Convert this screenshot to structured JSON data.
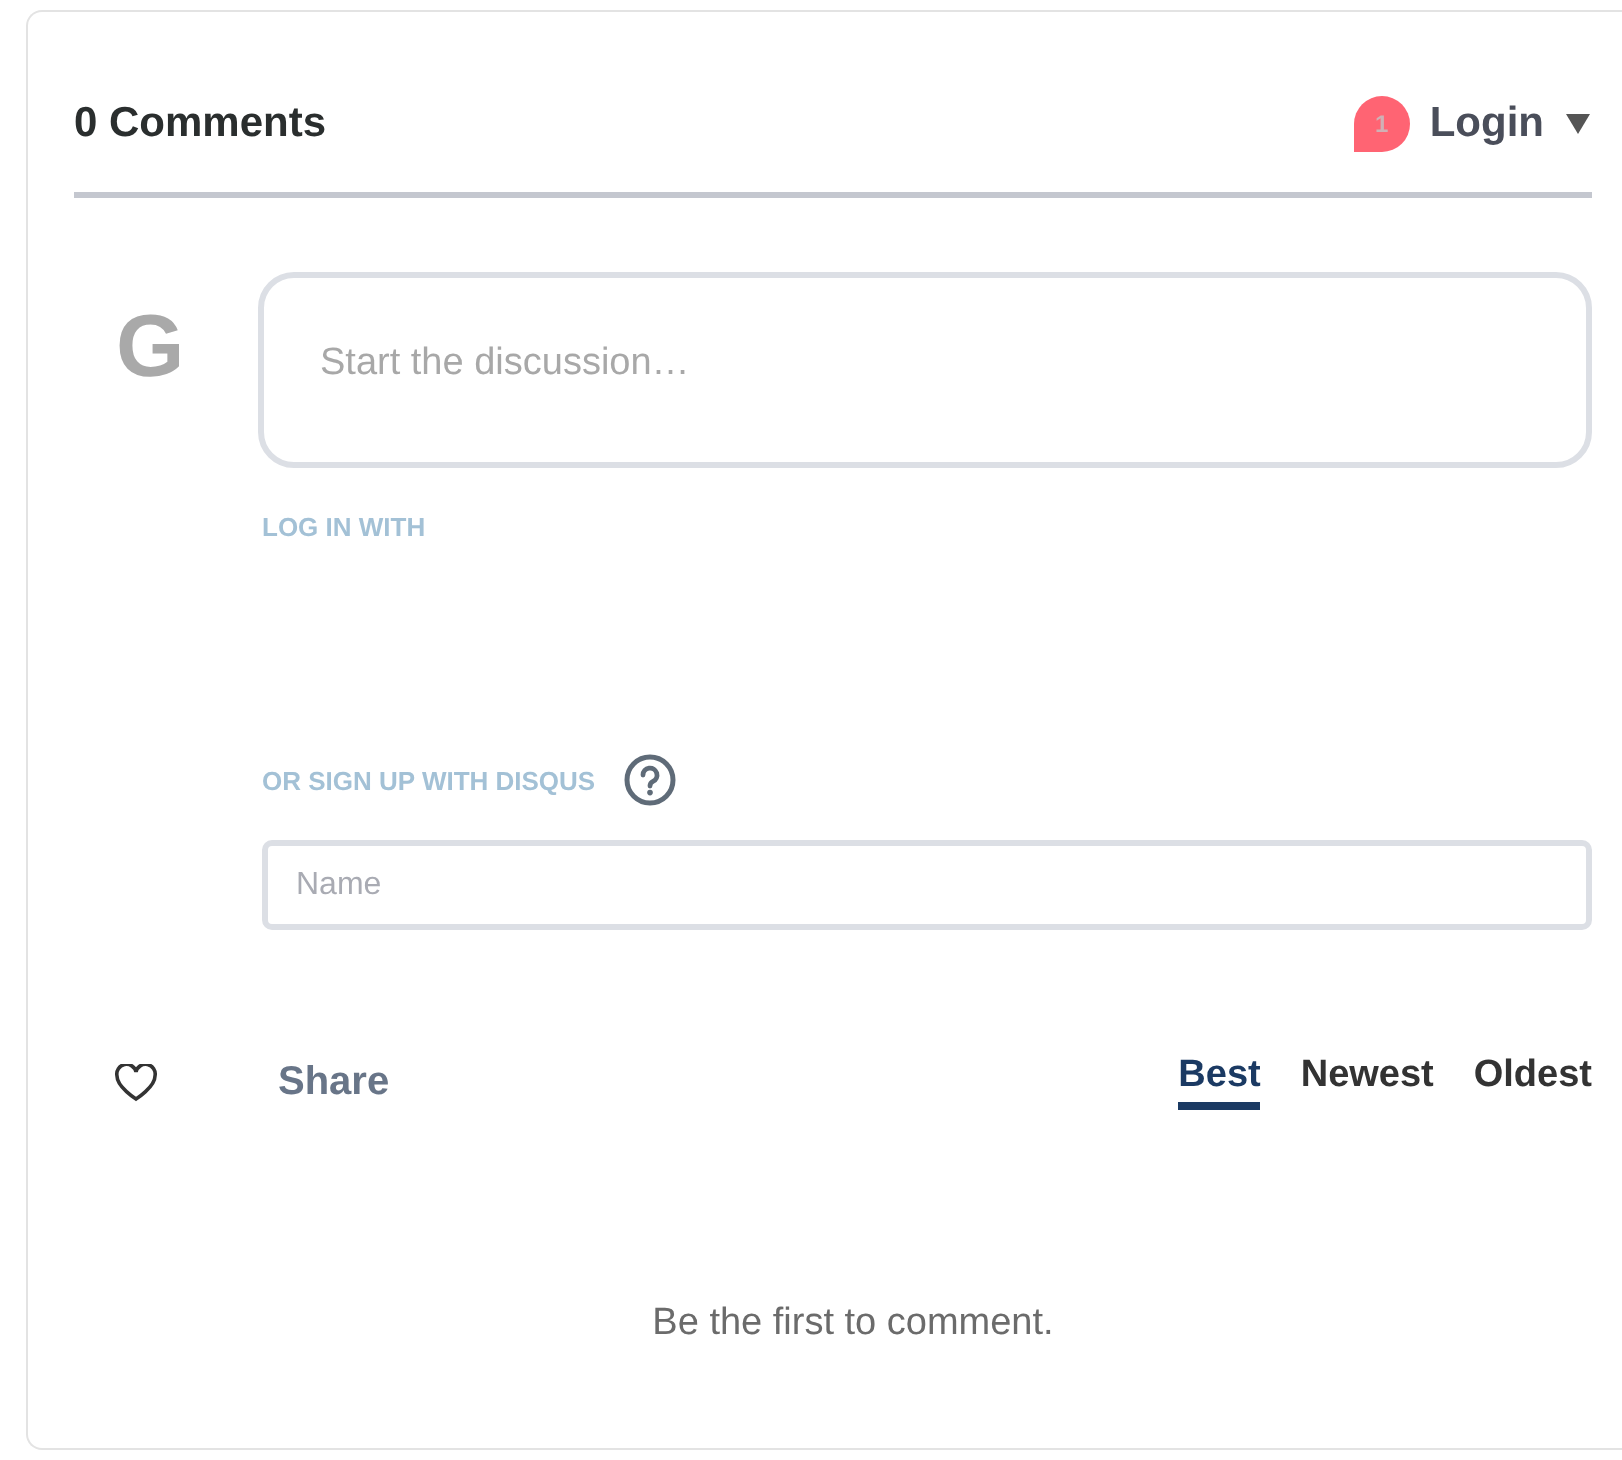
{
  "header": {
    "title": "0 Comments",
    "notification_count": "1",
    "login": "Login"
  },
  "composer": {
    "avatar_letter": "G",
    "placeholder": "Start the discussion…",
    "login_label": "LOG IN WITH",
    "signup_label": "OR SIGN UP WITH DISQUS",
    "name_placeholder": "Name"
  },
  "toolbar": {
    "share": "Share",
    "sort_tabs": [
      {
        "label": "Best",
        "selected": true
      },
      {
        "label": "Newest",
        "selected": false
      },
      {
        "label": "Oldest",
        "selected": false
      }
    ]
  },
  "empty_message": "Be the first to comment."
}
